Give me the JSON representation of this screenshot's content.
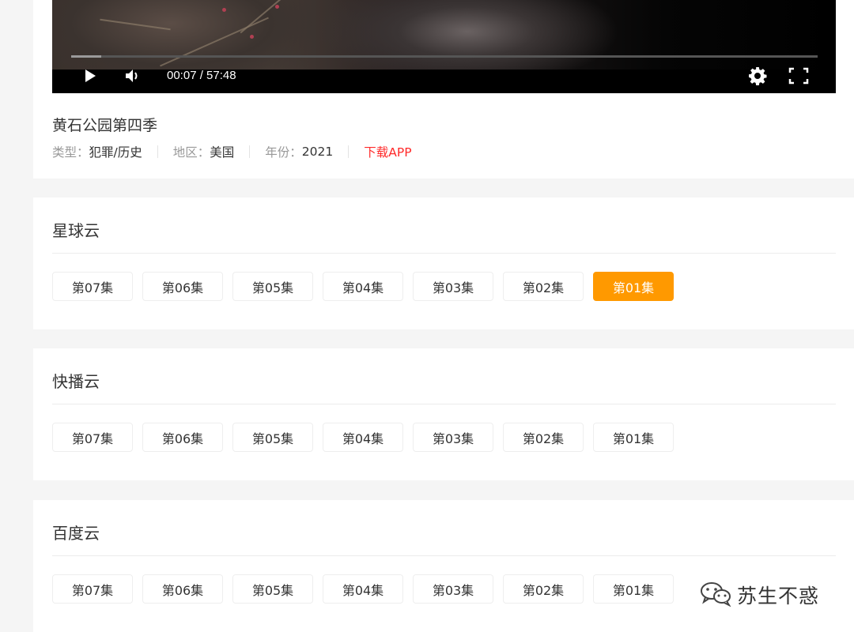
{
  "player": {
    "time_display": "00:07 / 57:48",
    "progress": 0.0404
  },
  "movie": {
    "title": "黄石公园第四季",
    "genre_label": "类型：",
    "genre_value": "犯罪/历史",
    "region_label": "地区：",
    "region_value": "美国",
    "year_label": "年份：",
    "year_value": "2021",
    "download_label": "下载APP"
  },
  "sources": [
    {
      "name": "星球云",
      "episodes": [
        "第07集",
        "第06集",
        "第05集",
        "第04集",
        "第03集",
        "第02集",
        "第01集"
      ],
      "active_episode": "第01集"
    },
    {
      "name": "快播云",
      "episodes": [
        "第07集",
        "第06集",
        "第05集",
        "第04集",
        "第03集",
        "第02集",
        "第01集"
      ],
      "active_episode": ""
    },
    {
      "name": "百度云",
      "episodes": [
        "第07集",
        "第06集",
        "第05集",
        "第04集",
        "第03集",
        "第02集",
        "第01集"
      ],
      "active_episode": ""
    }
  ],
  "watermark": {
    "text": "苏生不惑"
  },
  "colors": {
    "accent": "#ff9900",
    "download": "#ff2a2a",
    "page_bg": "#f5f5f5"
  },
  "icons": [
    "play-icon",
    "volume-icon",
    "gear-icon",
    "fullscreen-icon",
    "wechat-icon"
  ]
}
